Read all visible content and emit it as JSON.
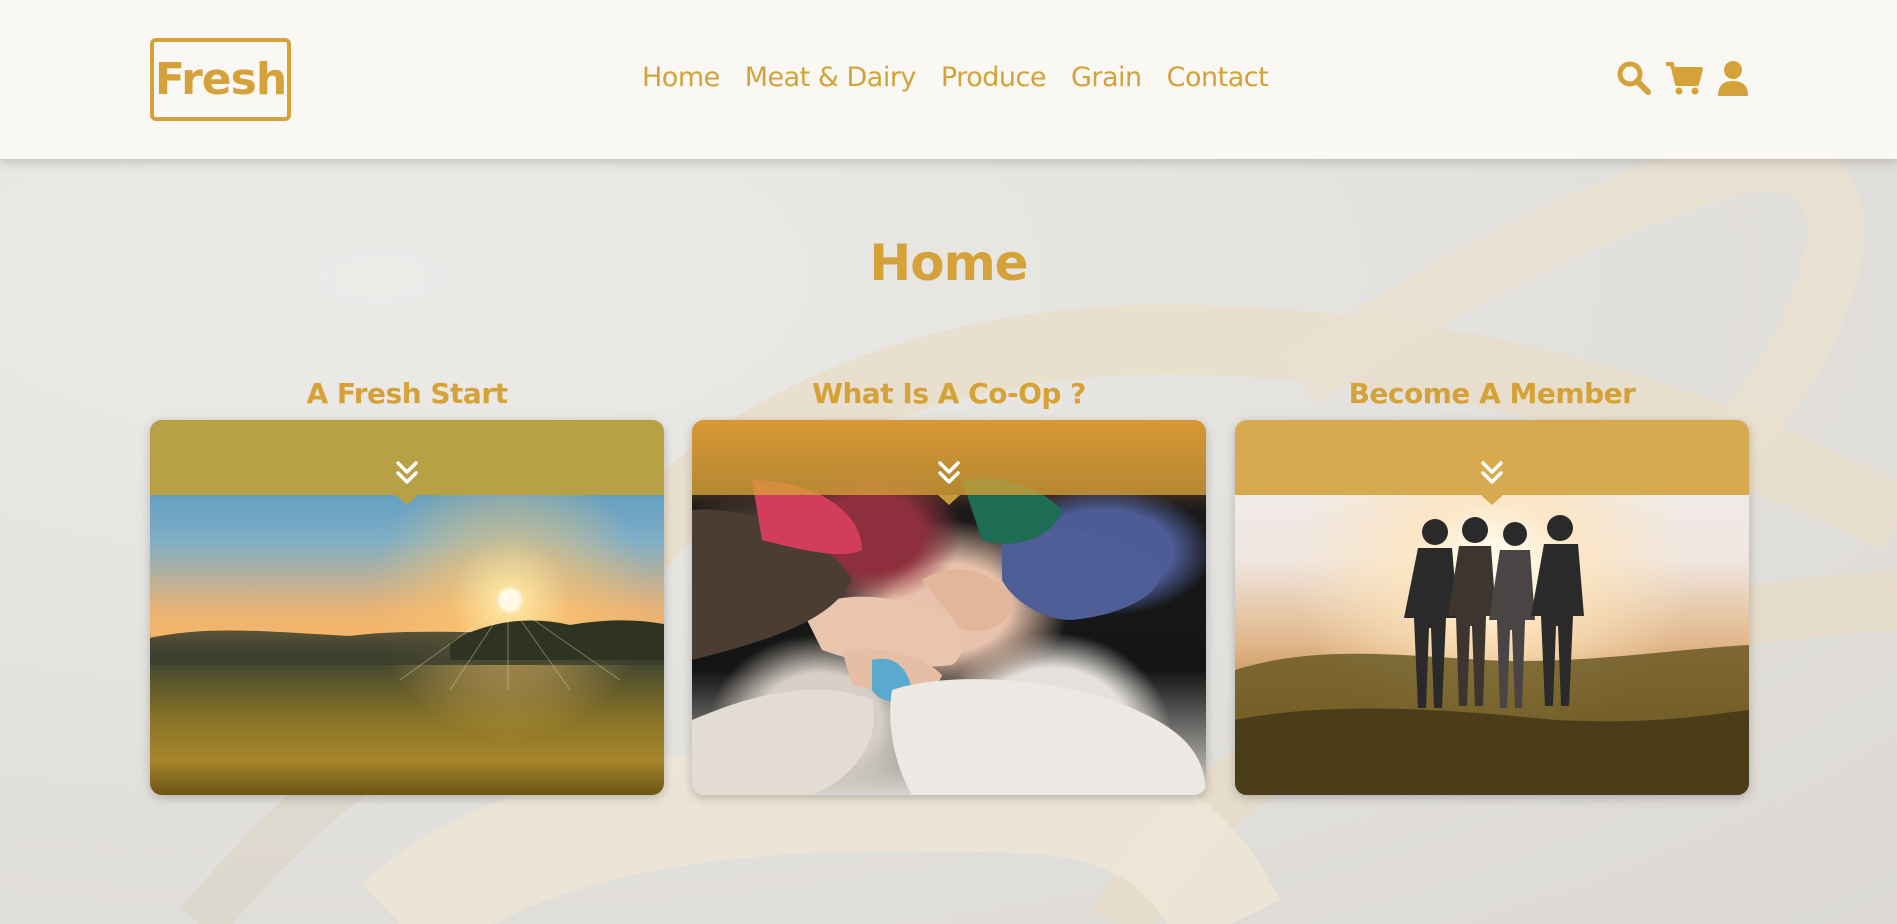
{
  "header": {
    "logo_text": "Fresh",
    "nav": [
      {
        "label": "Home"
      },
      {
        "label": "Meat & Dairy"
      },
      {
        "label": "Produce"
      },
      {
        "label": "Grain"
      },
      {
        "label": "Contact"
      }
    ],
    "icons": [
      "search-icon",
      "cart-icon",
      "user-icon"
    ]
  },
  "main": {
    "page_title": "Home",
    "cards": [
      {
        "title": "A Fresh Start",
        "image": "sunset field"
      },
      {
        "title": "What Is A Co-Op ?",
        "image": "hands stacked together"
      },
      {
        "title": "Become A Member",
        "image": "friends embracing at sunset"
      }
    ]
  },
  "colors": {
    "accent": "#d4a238",
    "header_bg": "#faf8f4",
    "chevron": "#ffffff"
  }
}
